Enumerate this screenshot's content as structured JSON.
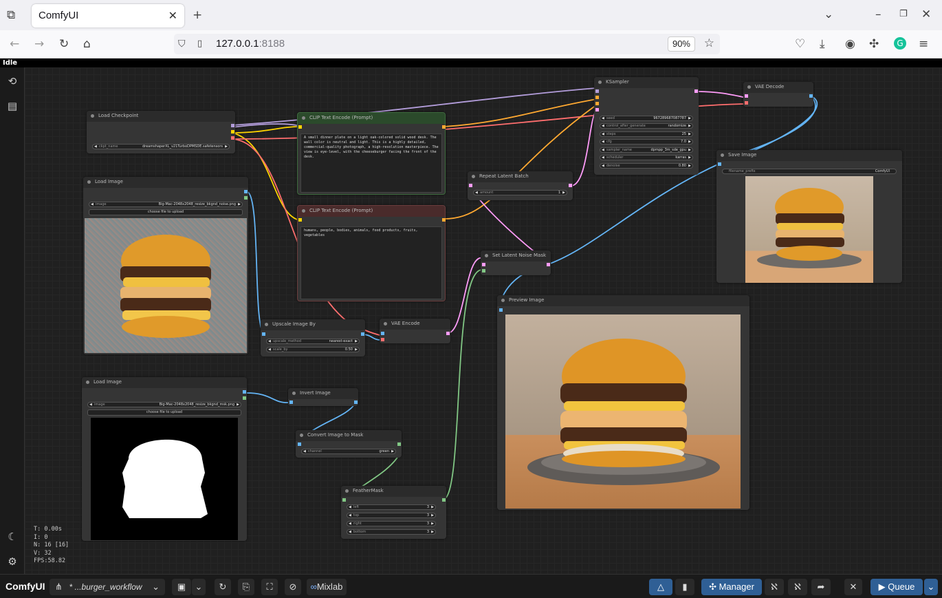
{
  "browser": {
    "tab_title": "ComfyUI",
    "url_host": "127.0.0.1",
    "url_port": ":8188",
    "zoom": "90%"
  },
  "status": "Idle",
  "stats": [
    "T: 0.00s",
    "I: 0",
    "N: 16 [16]",
    "V: 32",
    "FPS:58.82"
  ],
  "nodes": {
    "load_checkpoint": {
      "title": "Load Checkpoint",
      "ckpt_name_label": "ckpt_name",
      "ckpt_name": "dreamshaperXL_v21TurboDPMSDE.safetensors"
    },
    "clip_pos": {
      "title": "CLIP Text Encode (Prompt)",
      "text": "A small dinner plate on a light oak-colored solid wood desk. The wall color is neutral and light. This is a highly detailed, commercial-quality photograph, a high-resolution masterpiece. The view is eye-level, with the cheeseburger facing the front of the desk."
    },
    "clip_neg": {
      "title": "CLIP Text Encode (Prompt)",
      "text": "humans, people, bodies, animals, food products, fruits, vegetables"
    },
    "ksampler": {
      "title": "KSampler",
      "widgets": [
        {
          "name": "seed",
          "value": "967289687087787"
        },
        {
          "name": "control_after_generate",
          "value": "randomize"
        },
        {
          "name": "steps",
          "value": "25"
        },
        {
          "name": "cfg",
          "value": "7.0"
        },
        {
          "name": "sampler_name",
          "value": "dpmpp_3m_sde_gpu"
        },
        {
          "name": "scheduler",
          "value": "karras"
        },
        {
          "name": "denoise",
          "value": "0.80"
        }
      ]
    },
    "vae_decode": {
      "title": "VAE Decode"
    },
    "save_image": {
      "title": "Save Image",
      "prefix_label": "filename_prefix",
      "prefix": "ComfyUI"
    },
    "repeat_latent": {
      "title": "Repeat Latent Batch",
      "amount_label": "amount",
      "amount": "1"
    },
    "set_noise_mask": {
      "title": "Set Latent Noise Mask"
    },
    "load_image_1": {
      "title": "Load Image",
      "image_label": "image",
      "image": "Big-Mac-2048x2048_resize_bkgnd_noise.png",
      "upload": "choose file to upload"
    },
    "load_image_2": {
      "title": "Load Image",
      "image_label": "image",
      "image": "Big-Mac-2048x2048_resize_bkgnd_msk.png",
      "upload": "choose file to upload"
    },
    "upscale": {
      "title": "Upscale Image By",
      "method_label": "upscale_method",
      "method": "nearest-exact",
      "scale_label": "scale_by",
      "scale": "0.50"
    },
    "vae_encode": {
      "title": "VAE Encode"
    },
    "invert": {
      "title": "Invert Image"
    },
    "convert_mask": {
      "title": "Convert Image to Mask",
      "channel_label": "channel",
      "channel": "green"
    },
    "feather": {
      "title": "FeatherMask",
      "widgets": [
        {
          "name": "left",
          "value": "3"
        },
        {
          "name": "top",
          "value": "3"
        },
        {
          "name": "right",
          "value": "3"
        },
        {
          "name": "bottom",
          "value": "3"
        }
      ]
    },
    "preview": {
      "title": "Preview Image"
    }
  },
  "bottom": {
    "brand": "ComfyUI",
    "workflow": "* ...burger_workflow",
    "mixlab": "Mixlab",
    "manager": "Manager",
    "queue": "Queue"
  },
  "colors": {
    "accent": "#2f5f95",
    "clip_pos_header": "#2b4a2b",
    "clip_neg_header": "#4a2b2b"
  }
}
